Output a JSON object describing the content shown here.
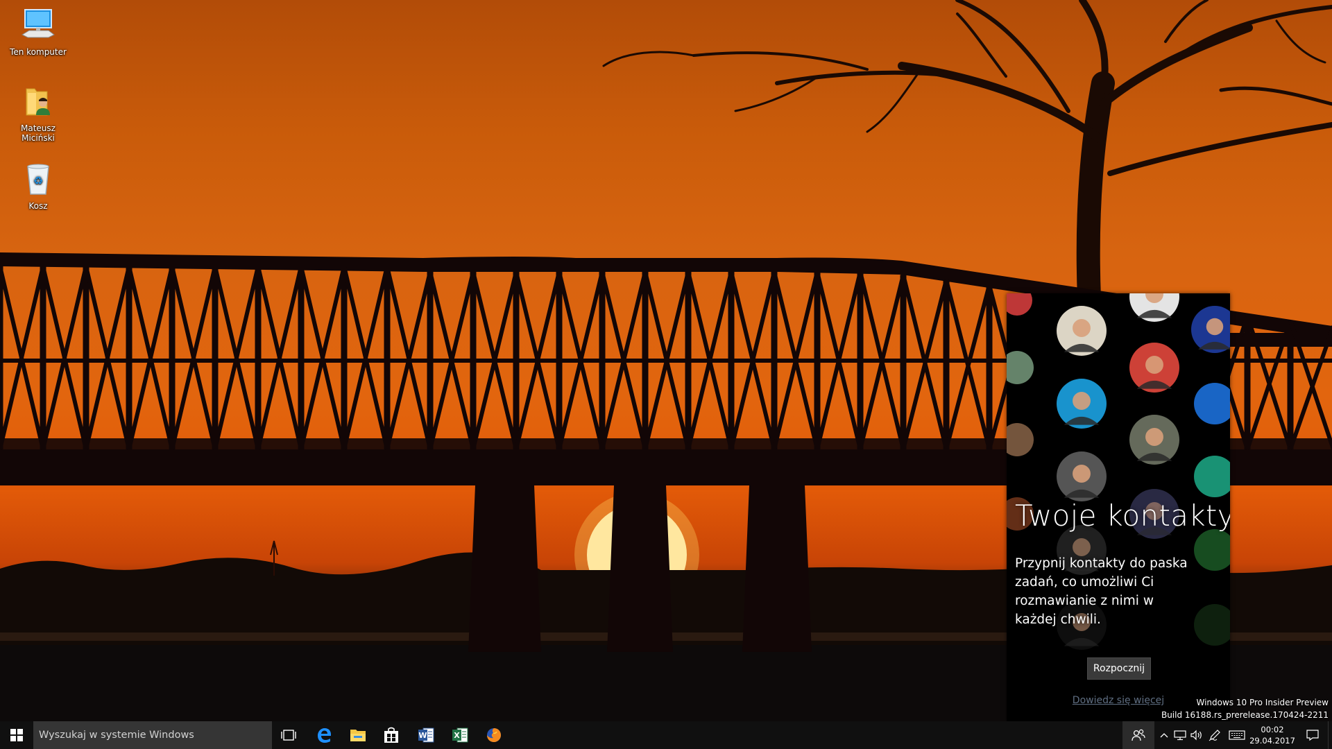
{
  "desktop": {
    "icons": [
      {
        "label": "Ten komputer",
        "icon": "computer-icon"
      },
      {
        "label": "Mateusz Miciński",
        "icon": "user-folder-icon"
      },
      {
        "label": "Kosz",
        "icon": "recycle-bin-icon"
      }
    ]
  },
  "people_flyout": {
    "title": "Twoje kontakty",
    "description": "Przypnij kontakty do paska zadań, co umożliwi Ci rozmawianie z nimi w każdej chwili.",
    "start_label": "Rozpocznij",
    "learn_more_label": "Dowiedz się więcej",
    "link_color": "#5f6e82"
  },
  "watermark": {
    "line1": "Windows 10 Pro Insider Preview",
    "line2": "Build 16188.rs_prerelease.170424-2211"
  },
  "taskbar": {
    "search_placeholder": "Wyszukaj w systemie Windows",
    "apps": [
      "task-view-icon",
      "edge-icon",
      "file-explorer-icon",
      "store-icon",
      "word-icon",
      "excel-icon",
      "firefox-icon"
    ],
    "clock": {
      "time": "00:02",
      "date": "29.04.2017"
    }
  },
  "colors": {
    "taskbar": "#101010",
    "search_box": "#353535",
    "sky_orange": "#e2650e",
    "edge_blue": "#1e90ff",
    "word_blue": "#2b579a",
    "excel_green": "#217346"
  }
}
